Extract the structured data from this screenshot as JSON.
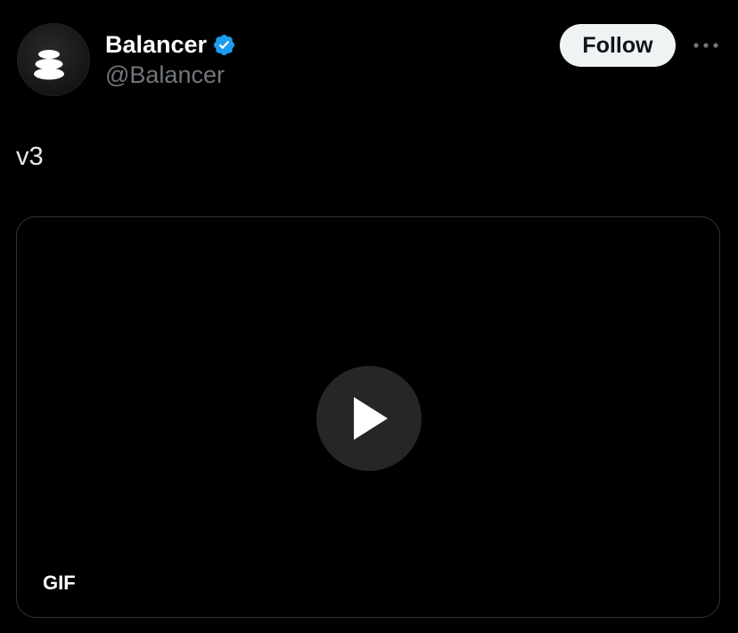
{
  "author": {
    "display_name": "Balancer",
    "handle": "@Balancer",
    "verified": true,
    "verified_color": "#1d9bf0",
    "avatar_icon": "balancer-logo-icon"
  },
  "actions": {
    "follow_label": "Follow",
    "more_icon": "more-horizontal-icon"
  },
  "tweet": {
    "text": "v3"
  },
  "media": {
    "type_badge": "GIF",
    "play_icon": "play-icon"
  },
  "colors": {
    "background": "#000000",
    "text_primary": "#e7e9ea",
    "text_secondary": "#71767b",
    "border": "#2f3336",
    "follow_bg": "#eff3f4"
  }
}
